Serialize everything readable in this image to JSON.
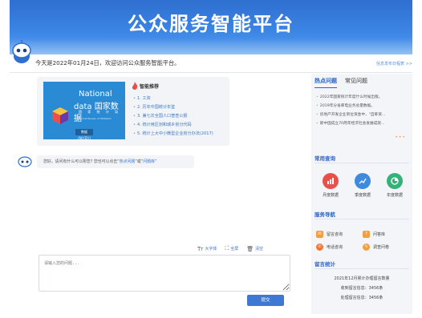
{
  "header": {
    "title": "公众服务智能平台"
  },
  "welcome": {
    "text": "今天是2022年01月24日，欢迎访问公众服务智能平台。",
    "release_link": "信息发布日程表 >>"
  },
  "recommend": {
    "card_image": {
      "line1": "National",
      "line2": "data 国家数据",
      "line3": "国 家 统 计 局",
      "line4": "National Bureau of Statistics",
      "badge": "数据(N/{D})"
    },
    "title": "智能推荐",
    "items": [
      "1. 工资",
      "2. 历年中国统计年鉴",
      "3. 第七次全国人口普查公报",
      "4. 统计用区划和城乡划分代码",
      "5. 统计上大中小微型企业划分办法(2017)"
    ]
  },
  "bot_message": {
    "prefix": "您好，请问有什么可以帮您? 您也可以点击“",
    "link1": "热点问题",
    "middle": "”或“",
    "link2": "问题库",
    "suffix": "”"
  },
  "toolbar": {
    "font_label": "大字体",
    "fullscreen_label": "全屏",
    "clear_label": "清空"
  },
  "input": {
    "placeholder": "请输入您的问题..."
  },
  "submit_label": "提交",
  "sidebar": {
    "tabs": [
      "热点问题",
      "常见问题"
    ],
    "hot_questions": [
      "2022年国家统计年度什么时候出版。",
      "2019年分省邮电业务总量数据。",
      "房地产开发企业到位资金中，\"自筹资...",
      "新中国成立70周年经济社会发展成就..."
    ],
    "more": "•••",
    "common_query": {
      "title": "常用查询",
      "items": [
        {
          "label": "月度数据",
          "icon": "bar-chart-icon",
          "color": "#e8504a"
        },
        {
          "label": "季度数据",
          "icon": "line-chart-icon",
          "color": "#3d8be0"
        },
        {
          "label": "年度数据",
          "icon": "pie-chart-icon",
          "color": "#34b27a"
        }
      ]
    },
    "service_nav": {
      "title": "服务导航",
      "items": [
        {
          "label": "留言咨询",
          "icon": "mail-icon",
          "color": "#f0a040"
        },
        {
          "label": "问答库",
          "icon": "qa-icon",
          "color": "#f0a040"
        },
        {
          "label": "电话咨询",
          "icon": "phone-icon",
          "color": "#f0782f"
        },
        {
          "label": "调查问卷",
          "icon": "survey-icon",
          "color": "#f0a040"
        }
      ]
    },
    "message_stats": {
      "title": "留言统计",
      "line1": "2021年12月累计办理留言数量",
      "line2": "收到留言信息：3456条",
      "line3": "处理留言信息：3456条"
    }
  }
}
